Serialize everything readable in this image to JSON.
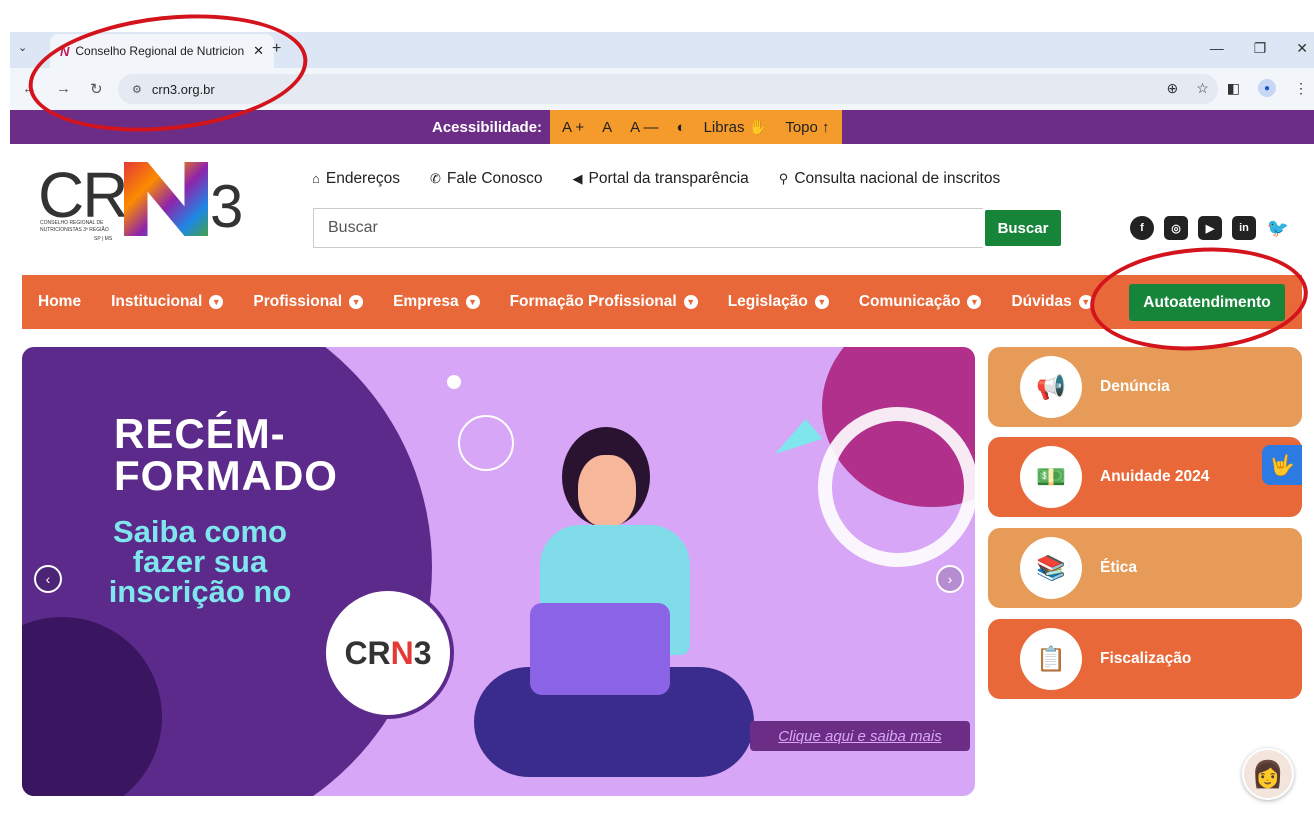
{
  "browser": {
    "tab_title": "Conselho Regional de Nutricion",
    "url": "crn3.org.br"
  },
  "accessibility": {
    "label": "Acessibilidade:",
    "font_increase": "A +",
    "font_default": "A",
    "font_decrease": "A —",
    "libras": "Libras",
    "top": "Topo ↑"
  },
  "header": {
    "logo_sub": "CONSELHO REGIONAL DE NUTRICIONISTAS 3ª REGIÃO",
    "logo_region": "SP | MS",
    "links": [
      {
        "label": "Endereços"
      },
      {
        "label": "Fale Conosco"
      },
      {
        "label": "Portal da transparência"
      },
      {
        "label": "Consulta nacional de inscritos"
      }
    ],
    "search_placeholder": "Buscar",
    "search_button": "Buscar"
  },
  "nav": {
    "items": [
      {
        "label": "Home"
      },
      {
        "label": "Institucional"
      },
      {
        "label": "Profissional"
      },
      {
        "label": "Empresa"
      },
      {
        "label": "Formação Profissional"
      },
      {
        "label": "Legislação"
      },
      {
        "label": "Comunicação"
      },
      {
        "label": "Dúvidas"
      }
    ],
    "self_service": "Autoatendimento"
  },
  "hero": {
    "title_line1": "RECÉM-",
    "title_line2": "FORMADO",
    "subtitle_line1": "Saiba como",
    "subtitle_line2": "fazer sua",
    "subtitle_line3": "inscrição no",
    "cta": "Clique aqui e saiba mais"
  },
  "cards": [
    {
      "label": "Denúncia",
      "icon": "megaphone-icon"
    },
    {
      "label": "Anuidade 2024",
      "icon": "money-icon"
    },
    {
      "label": "Ética",
      "icon": "books-icon"
    },
    {
      "label": "Fiscalização",
      "icon": "clipboard-icon"
    }
  ],
  "colors": {
    "purple": "#6c2d87",
    "orange": "#e8683a",
    "green": "#16853a",
    "light_orange": "#e69b58",
    "accent_yellow": "#f49b2c"
  }
}
